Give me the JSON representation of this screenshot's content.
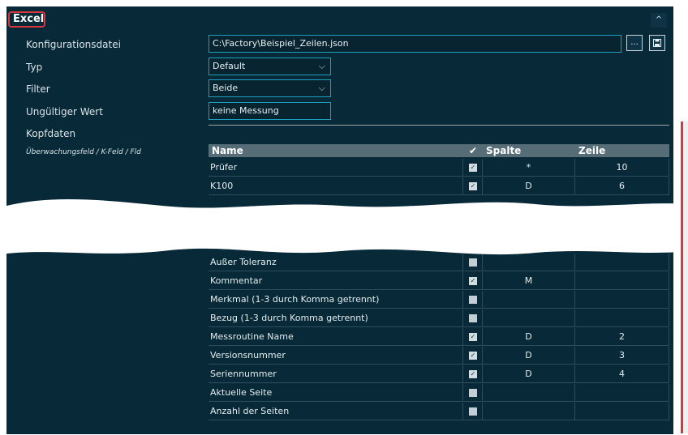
{
  "section": {
    "title": "Excel",
    "collapse_icon": "^"
  },
  "form": {
    "config_label": "Konfigurationsdatei",
    "config_value": "C:\\Factory\\Beispiel_Zeilen.json",
    "browse_label": "...",
    "save_icon": "floppy-disk-icon",
    "type_label": "Typ",
    "type_value": "Default",
    "filter_label": "Filter",
    "filter_value": "Beide",
    "invalid_label": "Ungültiger Wert",
    "invalid_value": "keine Messung",
    "header_label": "Kopfdaten",
    "monitor_label": "Überwachungsfeld / K-Feld / Fld"
  },
  "table": {
    "columns": {
      "name": "Name",
      "check": "✔",
      "spalte": "Spalte",
      "zeile": "Zeile"
    },
    "top_rows": [
      {
        "name": "Prüfer",
        "checked": true,
        "spalte": "*",
        "zeile": "10"
      },
      {
        "name": "K100",
        "checked": true,
        "spalte": "D",
        "zeile": "6"
      }
    ],
    "bottom_rows": [
      {
        "name": "Außer Toleranz",
        "checked": false,
        "spalte": "",
        "zeile": ""
      },
      {
        "name": "Kommentar",
        "checked": true,
        "spalte": "M",
        "zeile": ""
      },
      {
        "name": "Merkmal (1-3 durch Komma getrennt)",
        "checked": false,
        "spalte": "",
        "zeile": ""
      },
      {
        "name": "Bezug (1-3 durch Komma getrennt)",
        "checked": false,
        "spalte": "",
        "zeile": ""
      },
      {
        "name": "Messroutine Name",
        "checked": true,
        "spalte": "D",
        "zeile": "2"
      },
      {
        "name": "Versionsnummer",
        "checked": true,
        "spalte": "D",
        "zeile": "3"
      },
      {
        "name": "Seriennummer",
        "checked": true,
        "spalte": "D",
        "zeile": "4"
      },
      {
        "name": "Aktuelle Seite",
        "checked": false,
        "spalte": "",
        "zeile": ""
      },
      {
        "name": "Anzahl der Seiten",
        "checked": false,
        "spalte": "",
        "zeile": ""
      }
    ]
  },
  "colors": {
    "panel_bg": "#082a38",
    "accent": "#1d9fbf",
    "highlight": "#d9363e",
    "header_bg": "#566d77"
  }
}
